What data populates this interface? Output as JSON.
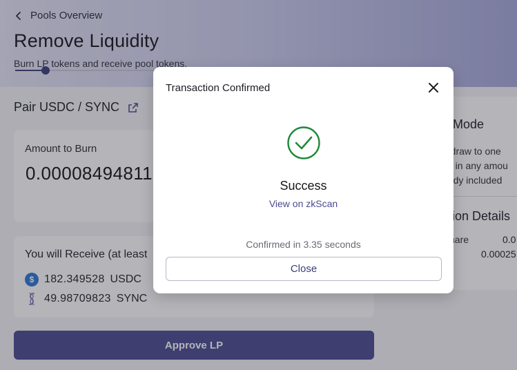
{
  "header": {
    "back_label": "Pools Overview",
    "title": "Remove Liquidity",
    "subtitle": "Burn LP tokens and receive pool tokens."
  },
  "pair": {
    "label": "Pair USDC / SYNC",
    "external_icon": "external-link-icon"
  },
  "burn": {
    "label": "Amount to Burn",
    "value": "0.00008494811",
    "slider_fraction": 0.09
  },
  "receive": {
    "title": "You will Receive (at least",
    "tokens": [
      {
        "amount": "182.349528",
        "symbol": "USDC",
        "icon": "usdc-icon"
      },
      {
        "amount": "49.98709823",
        "symbol": "SYNC",
        "icon": "sync-icon"
      }
    ]
  },
  "approve_label": "Approve LP",
  "right_panel": {
    "mode_title": "d Mode",
    "mode_lines": [
      "thdraw to one",
      "ts, in any amou",
      "eady included"
    ],
    "details_title": "ction Details",
    "detail_label": "hare",
    "detail_value_1": "0.0",
    "detail_value_2": "0.00025"
  },
  "modal": {
    "title": "Transaction Confirmed",
    "close_icon": "close-icon",
    "success_icon": "check-circle-icon",
    "status": "Success",
    "link": "View on zkScan",
    "confirmed": "Confirmed in 3.35 seconds",
    "button": "Close"
  },
  "colors": {
    "accent": "#4b4b8f",
    "success": "#1f8a3a",
    "usdc": "#2b77d4"
  }
}
